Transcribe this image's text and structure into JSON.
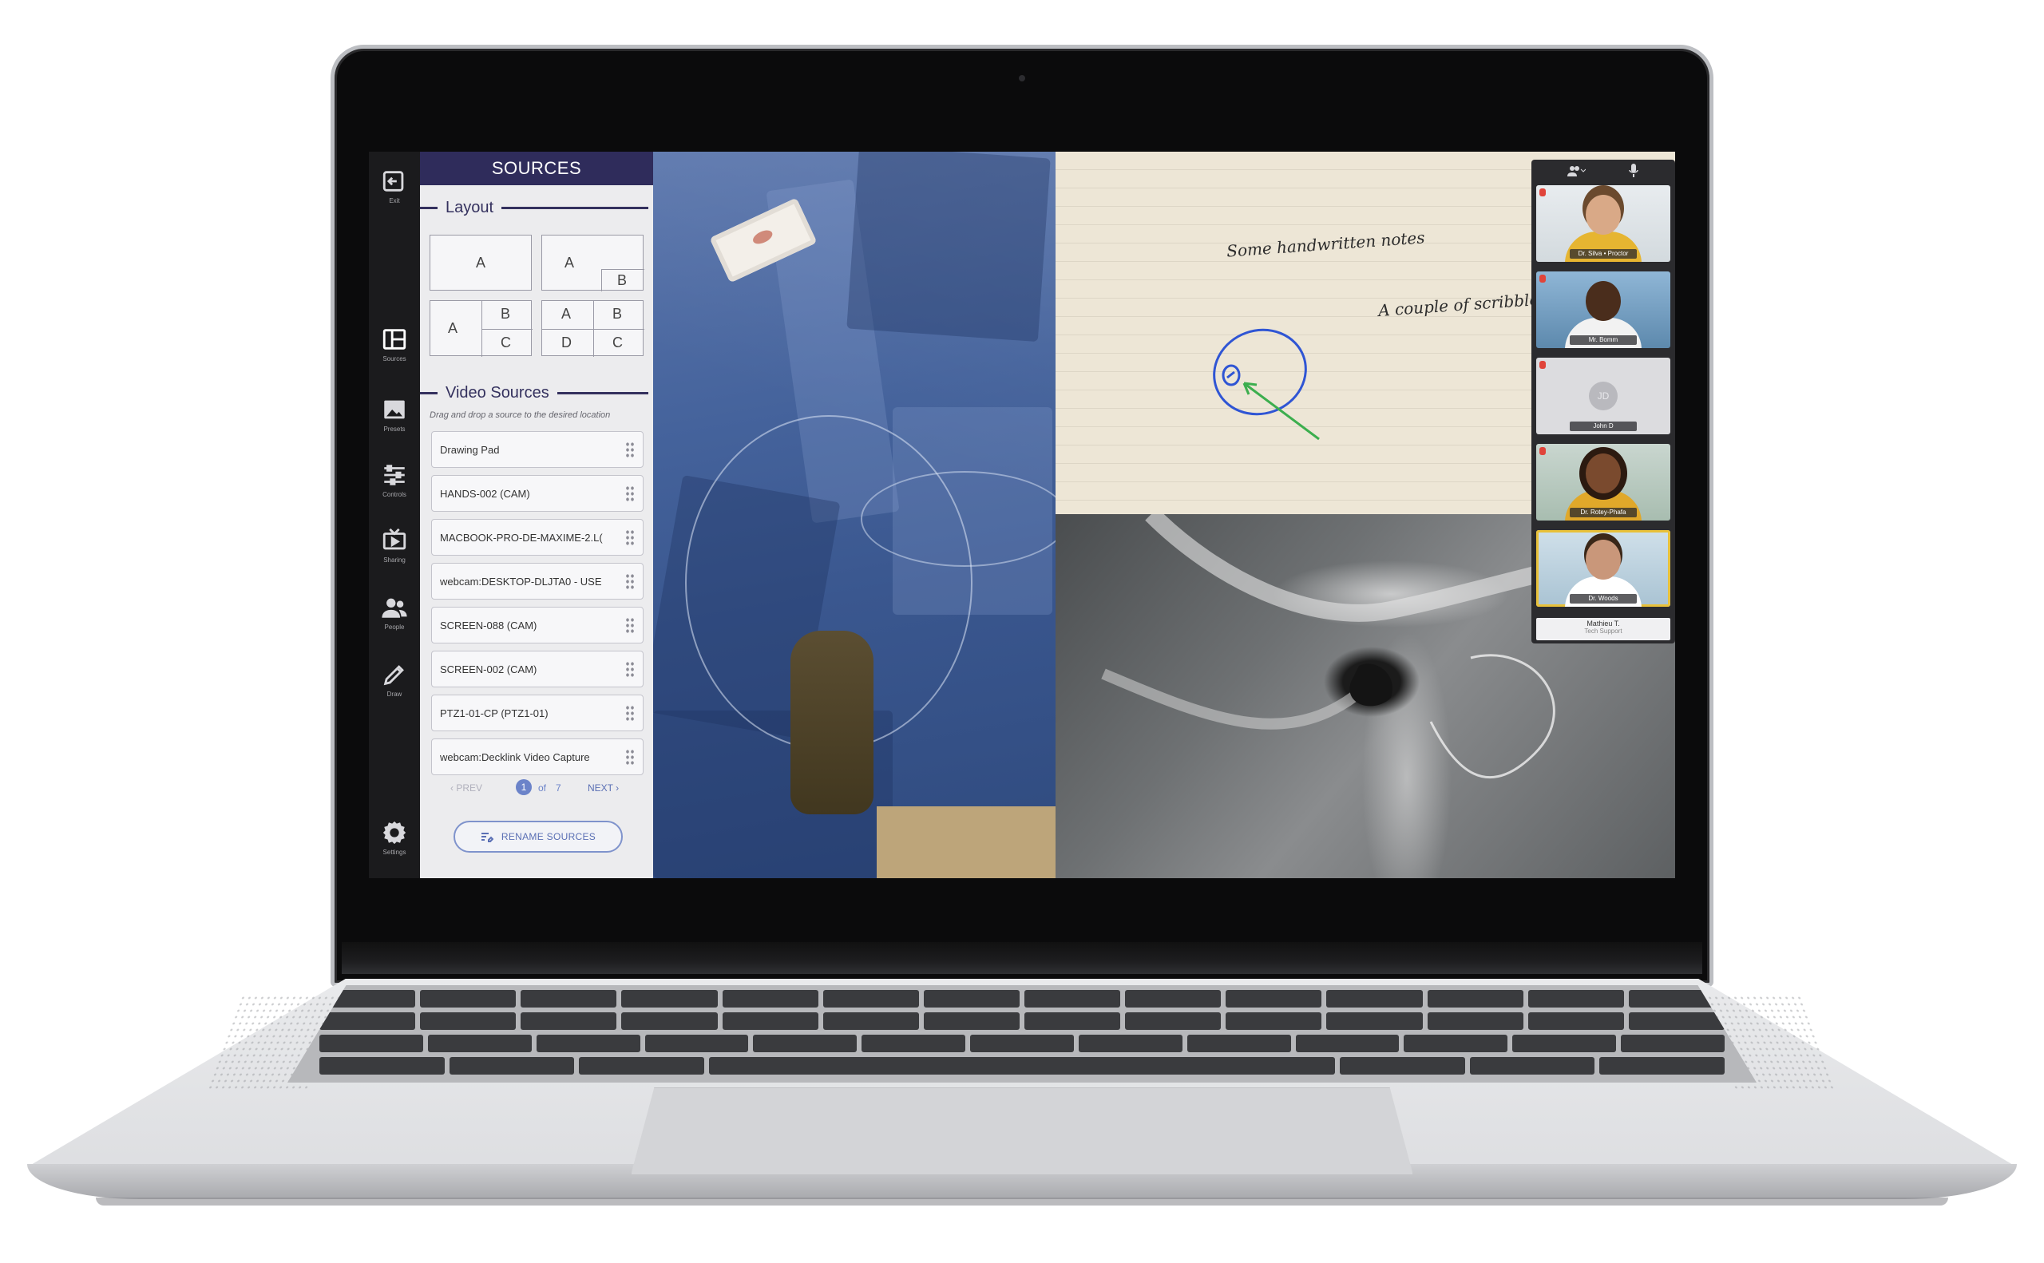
{
  "rail": {
    "items": [
      {
        "id": "exit",
        "label": "Exit"
      },
      {
        "id": "sources",
        "label": "Sources"
      },
      {
        "id": "presets",
        "label": "Presets"
      },
      {
        "id": "controls",
        "label": "Controls"
      },
      {
        "id": "sharing",
        "label": "Sharing"
      },
      {
        "id": "people",
        "label": "People"
      },
      {
        "id": "draw",
        "label": "Draw"
      },
      {
        "id": "settings",
        "label": "Settings"
      }
    ]
  },
  "sources": {
    "header": "SOURCES",
    "layout_title": "Layout",
    "layouts": {
      "single": [
        "A"
      ],
      "pip": [
        "A",
        "B"
      ],
      "three": [
        "A",
        "B",
        "C"
      ],
      "quad": [
        "A",
        "B",
        "D",
        "C"
      ]
    },
    "video_sources_title": "Video Sources",
    "hint": "Drag and drop a source to the desired location",
    "items": [
      "Drawing Pad",
      "HANDS-002 (CAM)",
      "MACBOOK-PRO-DE-MAXIME-2.L(",
      "webcam:DESKTOP-DLJTA0 - USE",
      "SCREEN-088 (CAM)",
      "SCREEN-002 (CAM)",
      "PTZ1-01-CP (PTZ1-01)",
      "webcam:Decklink Video Capture"
    ],
    "pager": {
      "prev": "‹ PREV",
      "page": "1",
      "of": "of",
      "total": "7",
      "next": "NEXT ›"
    },
    "rename_label": "RENAME SOURCES"
  },
  "whiteboard": {
    "note1": "Some handwritten notes",
    "note2": "A couple of scribble"
  },
  "participants": [
    {
      "name": "Dr. Silva • Proctor"
    },
    {
      "name": "Mr. Bomm"
    },
    {
      "name": "John D",
      "initials": "JD"
    },
    {
      "name": "Dr. Rotey-Phafa"
    },
    {
      "name": "Dr. Woods"
    }
  ],
  "participant_last": {
    "name": "Mathieu T.",
    "role": "Tech Support"
  },
  "colors": {
    "sources_header": "#2f2c5b",
    "accent": "#6b83c9",
    "rail_bg": "#1b1b1d"
  }
}
